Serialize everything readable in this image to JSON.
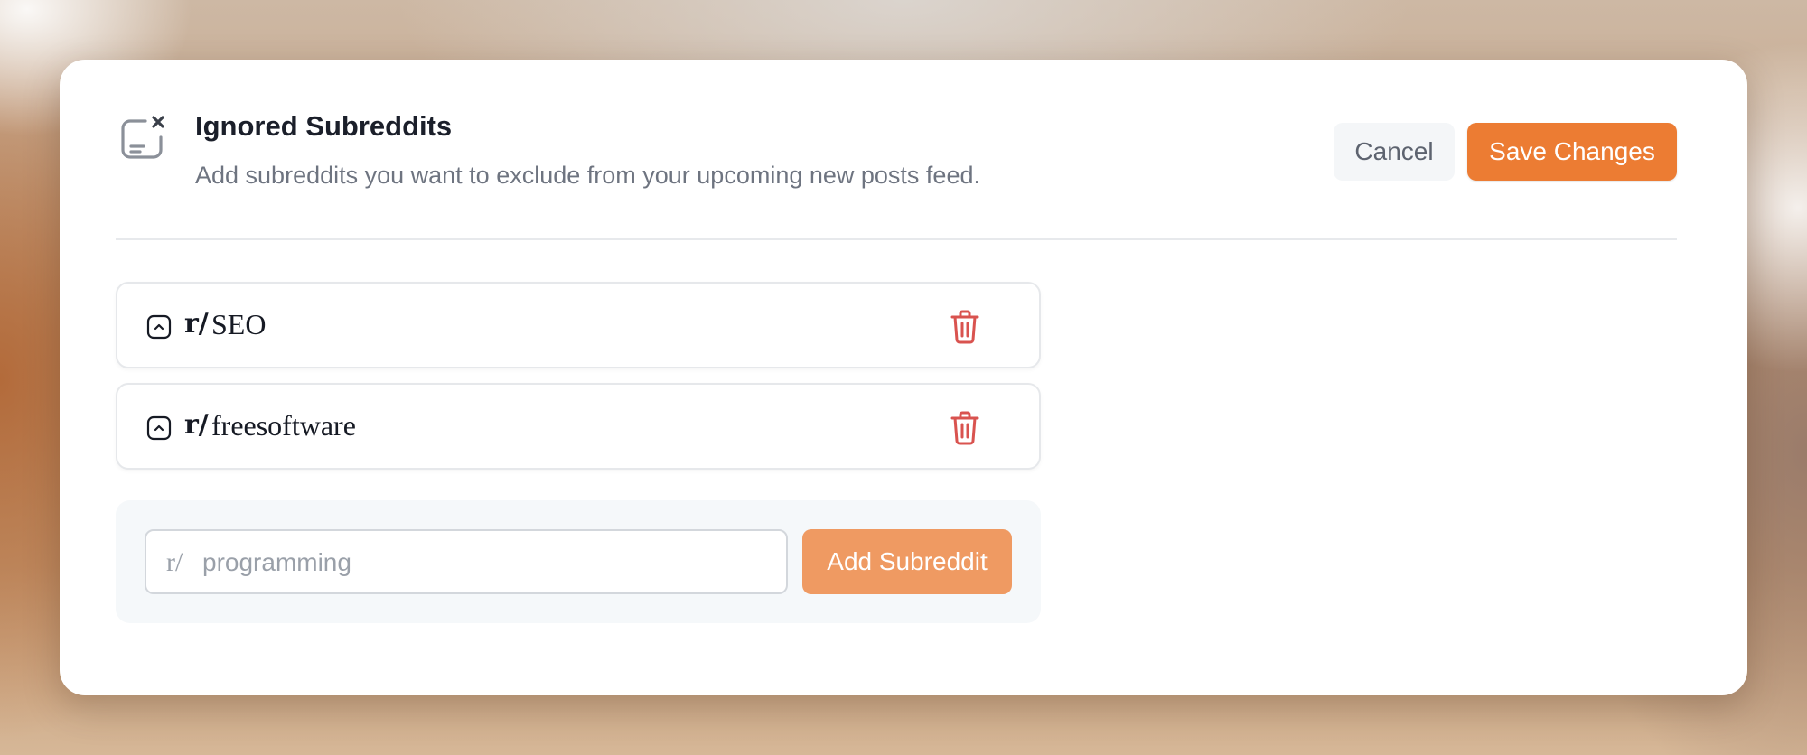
{
  "dialog": {
    "icon": "ignored-list-icon",
    "title": "Ignored Subreddits",
    "subtitle": "Add subreddits you want to exclude from your upcoming new posts feed.",
    "cancel_label": "Cancel",
    "save_label": "Save Changes"
  },
  "subreddits": [
    {
      "prefix": "r/",
      "name": "SEO",
      "icon": "chevron-up-square-icon",
      "delete_icon": "trash-icon"
    },
    {
      "prefix": "r/",
      "name": "freesoftware",
      "icon": "chevron-up-square-icon",
      "delete_icon": "trash-icon"
    }
  ],
  "add_form": {
    "prefix": "r/",
    "value": "",
    "placeholder": "programming",
    "button_label": "Add Subreddit"
  },
  "colors": {
    "accent": "#ec7c33",
    "accent_disabled": "#ef9a62",
    "danger": "#d9534f",
    "title": "#1b1f2a",
    "muted": "#6e7480"
  }
}
